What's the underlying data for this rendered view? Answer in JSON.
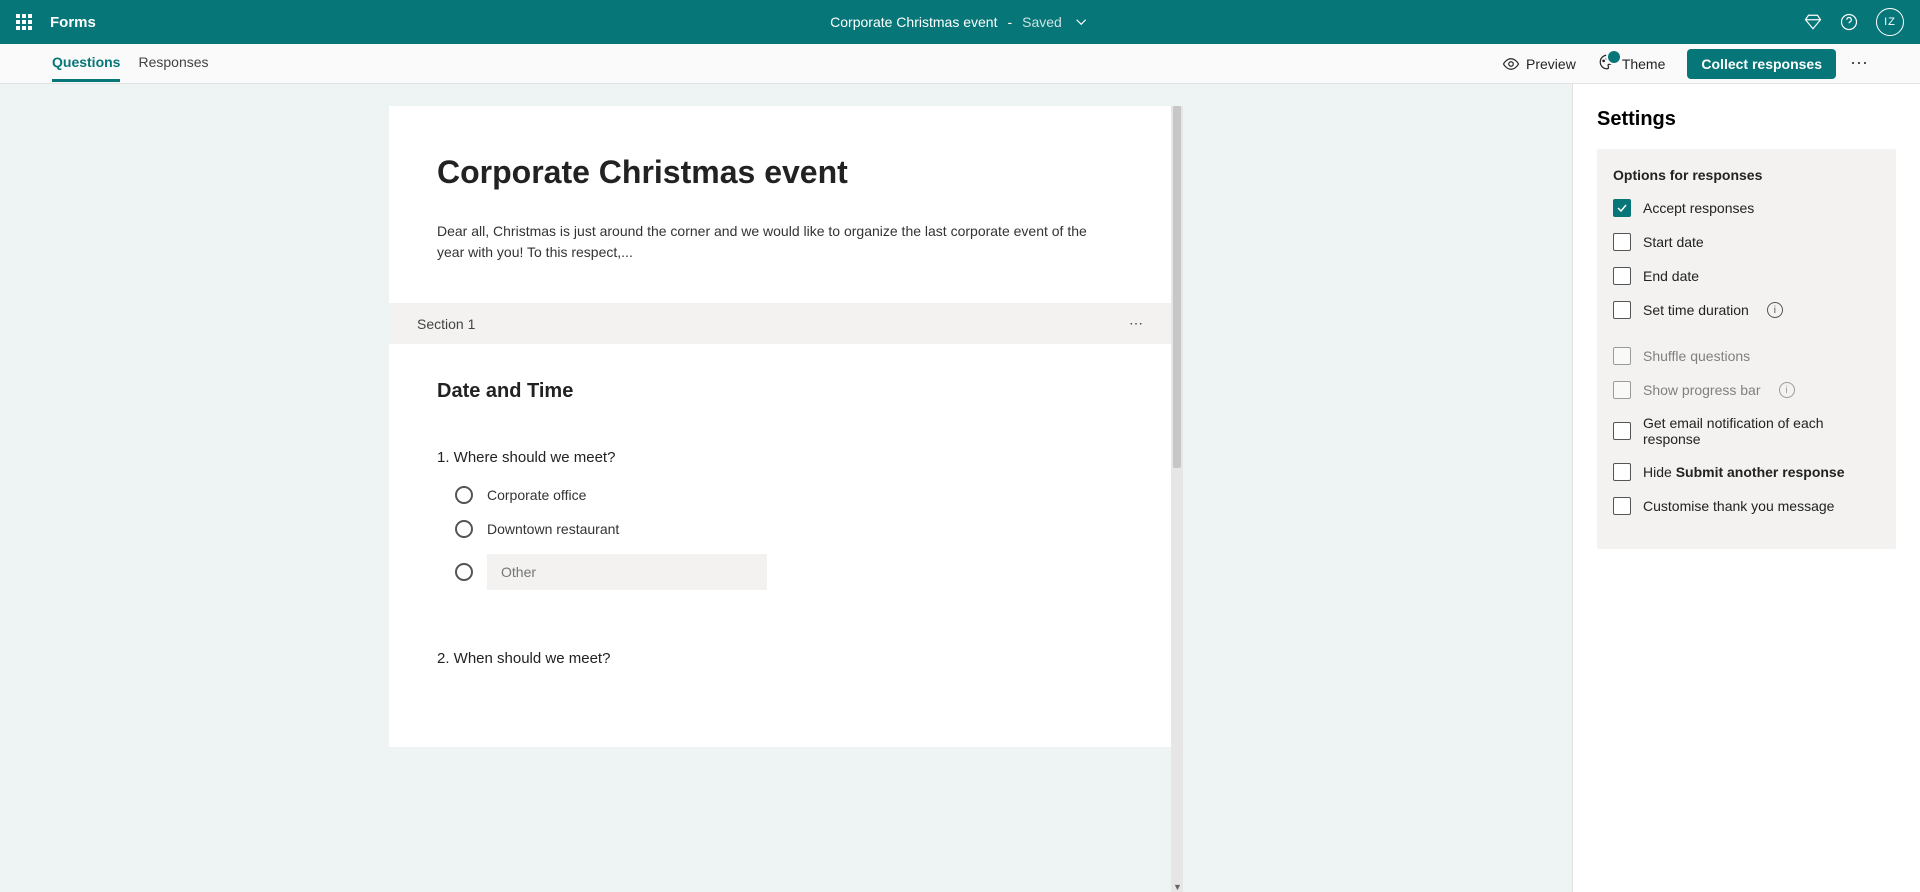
{
  "appbar": {
    "brand": "Forms",
    "doc_title": "Corporate Christmas event",
    "save_state": "Saved",
    "avatar_initials": "IZ"
  },
  "tabs": {
    "questions": "Questions",
    "responses": "Responses"
  },
  "actions": {
    "preview": "Preview",
    "theme": "Theme",
    "collect": "Collect responses"
  },
  "form": {
    "title": "Corporate Christmas event",
    "description": "Dear all, Christmas is just around the corner and we would like to organize the last corporate event of the year with you! To this respect,...",
    "section_label": "Section 1",
    "section_title": "Date and Time",
    "q1": {
      "text": "1. Where should we meet?",
      "opt1": "Corporate office",
      "opt2": "Downtown restaurant",
      "other_placeholder": "Other"
    },
    "q2": {
      "text": "2. When should we meet?"
    }
  },
  "settings": {
    "heading": "Settings",
    "panel_title": "Options for responses",
    "accept": "Accept responses",
    "start_date": "Start date",
    "end_date": "End date",
    "time_duration": "Set time duration",
    "shuffle": "Shuffle questions",
    "progress": "Show progress bar",
    "email_notify": "Get email notification of each response",
    "hide_submit_prefix": "Hide ",
    "hide_submit_bold": "Submit another response",
    "custom_thank": "Customise thank you message"
  }
}
